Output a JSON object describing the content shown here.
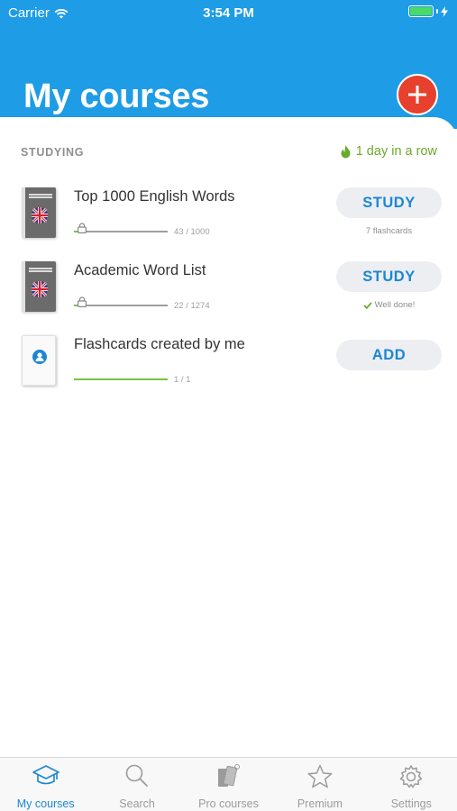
{
  "status_bar": {
    "carrier": "Carrier",
    "time": "3:54 PM"
  },
  "header": {
    "title": "My courses",
    "add_icon": "plus-icon",
    "accent": "#1E9CE5",
    "add_color": "#E7402D"
  },
  "section": {
    "label": "STUDYING",
    "streak": "1 day in a row",
    "streak_color": "#6BAA2A"
  },
  "courses": [
    {
      "name": "Top 1000 English Words",
      "progress_text": "43 / 1000",
      "progress": 0.043,
      "action": "STUDY",
      "sub": "7 flashcards",
      "cover": "uk-flag-book"
    },
    {
      "name": "Academic Word List",
      "progress_text": "22 / 1274",
      "progress": 0.017,
      "action": "STUDY",
      "sub": "Well done!",
      "cover": "uk-flag-book"
    },
    {
      "name": "Flashcards created by me",
      "progress_text": "1 / 1",
      "progress": 1.0,
      "action": "ADD",
      "sub": "",
      "cover": "person-book"
    }
  ],
  "tabs": [
    {
      "label": "My courses",
      "icon": "graduation-cap-icon",
      "active": true
    },
    {
      "label": "Search",
      "icon": "search-icon",
      "active": false
    },
    {
      "label": "Pro courses",
      "icon": "books-icon",
      "active": false
    },
    {
      "label": "Premium",
      "icon": "star-icon",
      "active": false
    },
    {
      "label": "Settings",
      "icon": "gear-icon",
      "active": false
    }
  ]
}
